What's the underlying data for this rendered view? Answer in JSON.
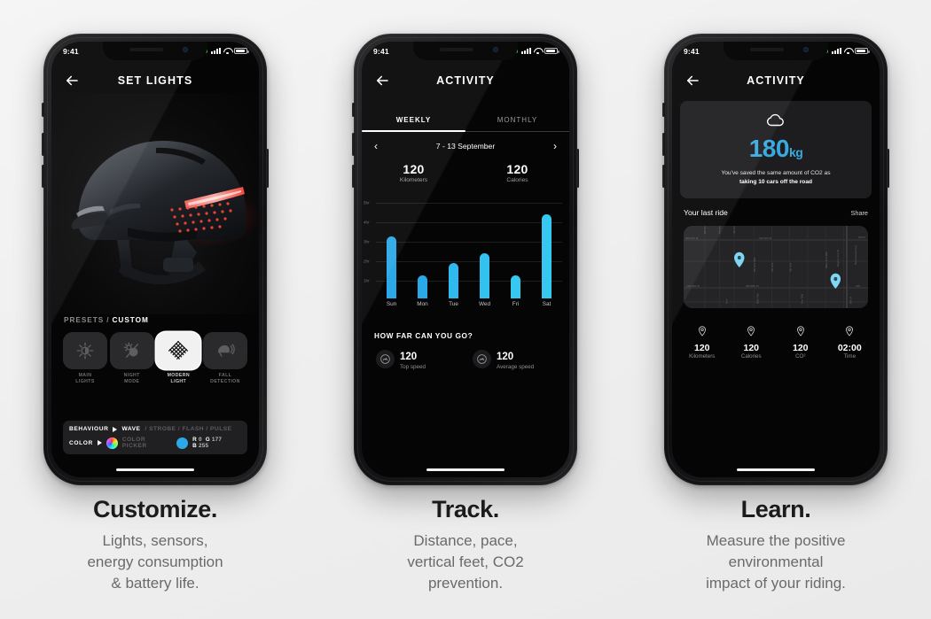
{
  "accent": {
    "blue": "#2aa8e8",
    "cyan": "#36c8f0",
    "co2_blue": "#3aa9e0",
    "pin_blue": "#7fd6f2"
  },
  "status_bar": {
    "time": "9:41"
  },
  "panels": [
    {
      "id": "customize",
      "caption_title": "Customize.",
      "caption_lines": [
        "Lights, sensors,",
        "energy consumption",
        "& battery life."
      ],
      "screen": {
        "header_title": "SET LIGHTS",
        "back_icon": "arrow-left-icon",
        "hero_image": "bike-helmet-with-red-led-taillight",
        "presets_label": "PRESETS",
        "presets_separator": "/",
        "custom_label": "CUSTOM",
        "presets": [
          {
            "icon": "main-lights-icon",
            "line1": "MAIN",
            "line2": "LIGHTS",
            "active": false
          },
          {
            "icon": "night-mode-icon",
            "line1": "NIGHT",
            "line2": "MODE",
            "active": false
          },
          {
            "icon": "modern-light-icon",
            "line1": "MODERN",
            "line2": "LIGHT",
            "active": true
          },
          {
            "icon": "fall-detection-icon",
            "line1": "FALL",
            "line2": "DETECTION",
            "active": false
          }
        ],
        "behaviour": {
          "key": "BEHAVIOUR",
          "selected": "WAVE",
          "options_rest": "/ STROBE / FLASH / PULSE"
        },
        "color": {
          "key": "COLOR",
          "picker_label": "COLOR PICKER",
          "swatch_hex": "#2aa8e8",
          "r_key": "R",
          "r_val": "0",
          "g_key": "G",
          "g_val": "177",
          "b_key": "B",
          "b_val": "255"
        }
      }
    },
    {
      "id": "track",
      "caption_title": "Track.",
      "caption_lines": [
        "Distance, pace,",
        "vertical feet, CO2",
        "prevention."
      ],
      "screen": {
        "header_title": "ACTIVITY",
        "back_icon": "arrow-left-icon",
        "tabs": [
          {
            "label": "WEEKLY",
            "active": true
          },
          {
            "label": "MONTHLY",
            "active": false
          }
        ],
        "week_range": "7 - 13 September",
        "prev_icon": "chevron-left-icon",
        "next_icon": "chevron-right-icon",
        "summary": [
          {
            "value": "120",
            "label": "Kilometers"
          },
          {
            "value": "120",
            "label": "Calories"
          }
        ],
        "section_title": "HOW FAR CAN YOU GO?",
        "speeds": [
          {
            "icon": "speedometer-icon",
            "value": "120",
            "label": "Top speed"
          },
          {
            "icon": "speedometer-icon",
            "value": "120",
            "label": "Average speed"
          }
        ]
      }
    },
    {
      "id": "learn",
      "caption_title": "Learn.",
      "caption_lines": [
        "Measure the positive",
        "environmental",
        "impact of your riding."
      ],
      "screen": {
        "header_title": "ACTIVITY",
        "back_icon": "arrow-left-icon",
        "co2": {
          "icon": "cloud-icon",
          "value": "180",
          "unit": "kg",
          "line1": "You've saved the same amount of CO2 as",
          "line2": "taking 10 cars off the road"
        },
        "last_ride_title": "Your last ride",
        "share_label": "Share",
        "map": {
          "name": "last-ride-route-map",
          "street_labels": [
            "NW 67th St",
            "NW 67th St",
            "NW 65th St",
            "NW 65th St"
          ],
          "pins": 2
        },
        "stats": [
          {
            "icon": "pin-icon",
            "value": "120",
            "label": "Kilometers"
          },
          {
            "icon": "pin-icon",
            "value": "120",
            "label": "Calories"
          },
          {
            "icon": "pin-icon",
            "value": "120",
            "label": "CO²"
          },
          {
            "icon": "pin-icon",
            "value": "02:00",
            "label": "Time"
          }
        ]
      }
    }
  ],
  "chart_data": {
    "type": "bar",
    "title": "",
    "categories": [
      "Sun",
      "Mon",
      "Tue",
      "Wed",
      "Fri",
      "Sat"
    ],
    "values": [
      3.2,
      1.2,
      1.8,
      2.3,
      1.2,
      4.3
    ],
    "ylim": [
      0,
      5
    ],
    "ytick_labels": [
      "5hr",
      "4hr",
      "3hr",
      "2hr",
      "1hr"
    ],
    "ylabel": "",
    "xlabel": "",
    "grid": true,
    "legend": "none",
    "bar_colors": [
      "#2aa8e8",
      "#2aa8e8",
      "#2fb9ee",
      "#33c2ef",
      "#36c8f0",
      "#36c8f0"
    ]
  }
}
